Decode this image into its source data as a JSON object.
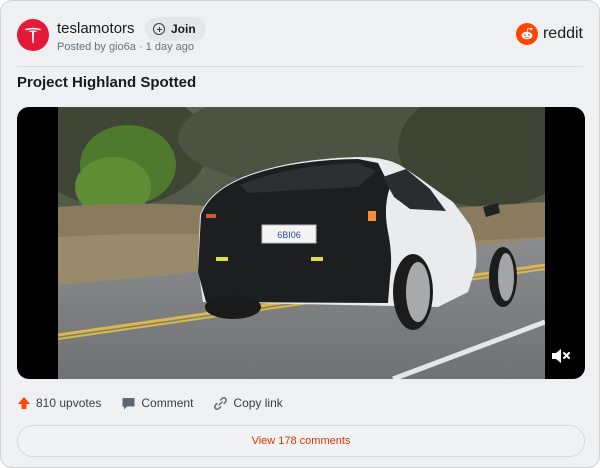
{
  "post": {
    "subreddit": "teslamotors",
    "join_label": "Join",
    "meta": "Posted by gio6a · 1 day ago",
    "brand": "reddit",
    "title": "Project Highland Spotted",
    "plate": "6BI06",
    "upvotes_label": "810 upvotes",
    "comment_label": "Comment",
    "copy_label": "Copy link",
    "view_comments_label": "View 178 comments"
  },
  "icons": {
    "avatar": "tesla-logo-icon",
    "join": "plus-circle-icon",
    "brand": "reddit-logo-icon",
    "upvote": "upvote-arrow-icon",
    "comment": "comment-bubble-icon",
    "copy": "link-icon",
    "mute": "speaker-muted-icon"
  },
  "colors": {
    "accent": "#ff4500",
    "tesla_red": "#e31937",
    "link_text": "#d93900"
  }
}
